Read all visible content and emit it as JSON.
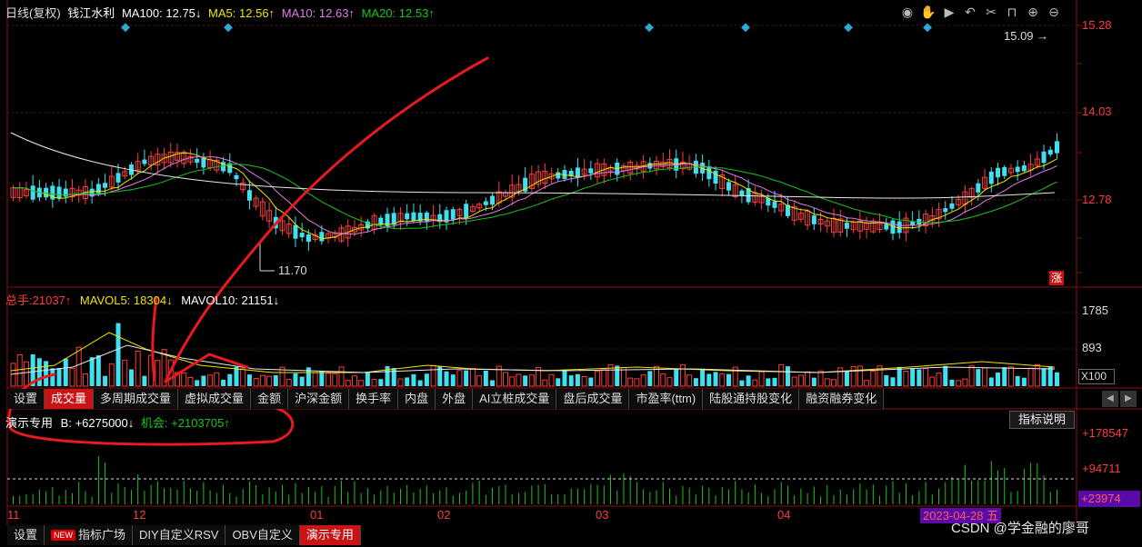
{
  "price_header": {
    "title": "日线(复权)",
    "stock": "钱江水利",
    "ma100_label": "MA100:",
    "ma100_value": "12.75↓",
    "ma5_label": "MA5:",
    "ma5_value": "12.56↑",
    "ma10_label": "MA10:",
    "ma10_value": "12.63↑",
    "ma20_label": "MA20:",
    "ma20_value": "12.53↑"
  },
  "price_axis": {
    "top": "15.28",
    "mid": "14.03",
    "low": "12.78"
  },
  "price_marks": {
    "high_mark": "15.09",
    "low_mark": "11.70",
    "zhang": "涨"
  },
  "toolbar_icons": [
    "eye-icon",
    "hand-icon",
    "play-icon",
    "undo-icon",
    "scissors-icon",
    "lock-icon",
    "zoom-in-icon",
    "zoom-out-icon"
  ],
  "volume_header": {
    "total_label": "总手:",
    "total_value": "21037↑",
    "mavol5_label": "MAVOL5:",
    "mavol5_value": "18304↓",
    "mavol10_label": "MAVOL10:",
    "mavol10_value": "21151↓"
  },
  "volume_axis": {
    "top": "1785",
    "mid": "893",
    "unit": "X100"
  },
  "tabs_mid": [
    "设置",
    "成交量",
    "多周期成交量",
    "虚拟成交量",
    "金额",
    "沪深金额",
    "换手率",
    "内盘",
    "外盘",
    "AI立桩成交量",
    "盘后成交量",
    "市盈率(ttm)",
    "陆股通持股变化",
    "融资融券变化"
  ],
  "indicator": {
    "name": "演示专用",
    "b_label": "B:",
    "b_value": "+6275000↓",
    "chance_label": "机会:",
    "chance_value": "+2103705↑",
    "explain_button": "指标说明"
  },
  "indicator_axis": {
    "top": "+178547",
    "mid": "+94711",
    "low": "+23974"
  },
  "months": [
    "11",
    "12",
    "01",
    "02",
    "03",
    "04"
  ],
  "cursor_date": "2023-04-28 五",
  "tabs_bottom": [
    {
      "label": "设置",
      "is_new": false
    },
    {
      "label": "指标广场",
      "is_new": true
    },
    {
      "label": "DIY自定义RSV",
      "is_new": false
    },
    {
      "label": "OBV自定义",
      "is_new": false
    },
    {
      "label": "演示专用",
      "is_new": false
    }
  ],
  "new_badge": "NEW",
  "watermark": "CSDN @学金融的廖哥",
  "colors": {
    "up": "#ff3b3b",
    "down": "#3fe0f0",
    "ma5": "#f2e400",
    "ma10": "#e07ee0",
    "ma20": "#19c419",
    "ma100": "#e8e8e8",
    "indicator": "#19c419",
    "annotation": "#e8191f"
  }
}
